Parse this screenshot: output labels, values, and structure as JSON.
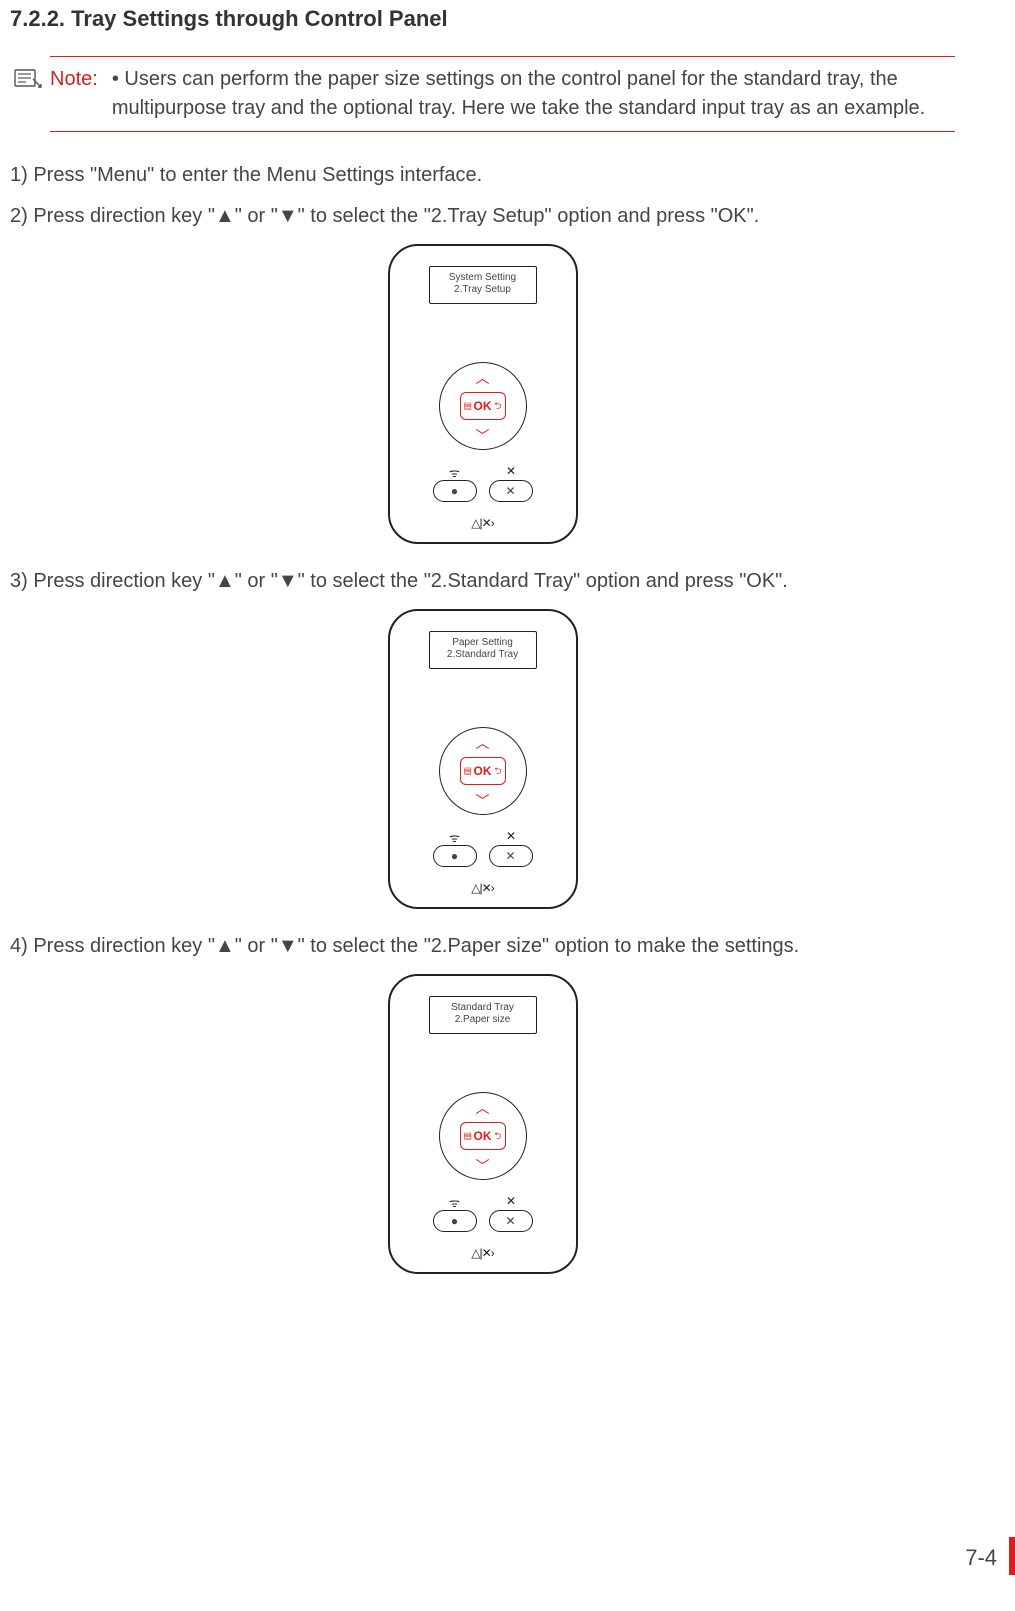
{
  "heading": "7.2.2. Tray Settings through Control Panel",
  "note": {
    "label": "Note:",
    "text": "• Users can perform the paper size settings on the control panel for the standard tray, the multipurpose tray and the optional tray. Here we take the standard input tray as an example."
  },
  "steps": {
    "s1": "1) Press \"Menu\" to enter the Menu Settings interface.",
    "s2": "2) Press direction key \"▲\" or \"▼\" to select the \"2.Tray Setup\" option and press \"OK\".",
    "s3": "3) Press direction key \"▲\" or \"▼\" to select the \"2.Standard Tray\" option and press \"OK\".",
    "s4": "4) Press direction key \"▲\" or \"▼\" to select the \"2.Paper size\" option to make the settings."
  },
  "panels": {
    "p1": {
      "line1": "System Setting",
      "line2": "2.Tray Setup"
    },
    "p2": {
      "line1": "Paper Setting",
      "line2": "2.Standard Tray"
    },
    "p3": {
      "line1": "Standard Tray",
      "line2": "2.Paper size"
    }
  },
  "panel_common": {
    "ok": "OK",
    "menu_glyph": "▤",
    "back_glyph": "⮌",
    "up": "︿",
    "down": "﹀",
    "wifi": "ᯤ",
    "x_small": "✕",
    "dot": "●",
    "x_btn": "✕",
    "bottom": "△|✕›"
  },
  "page_number": "7-4"
}
